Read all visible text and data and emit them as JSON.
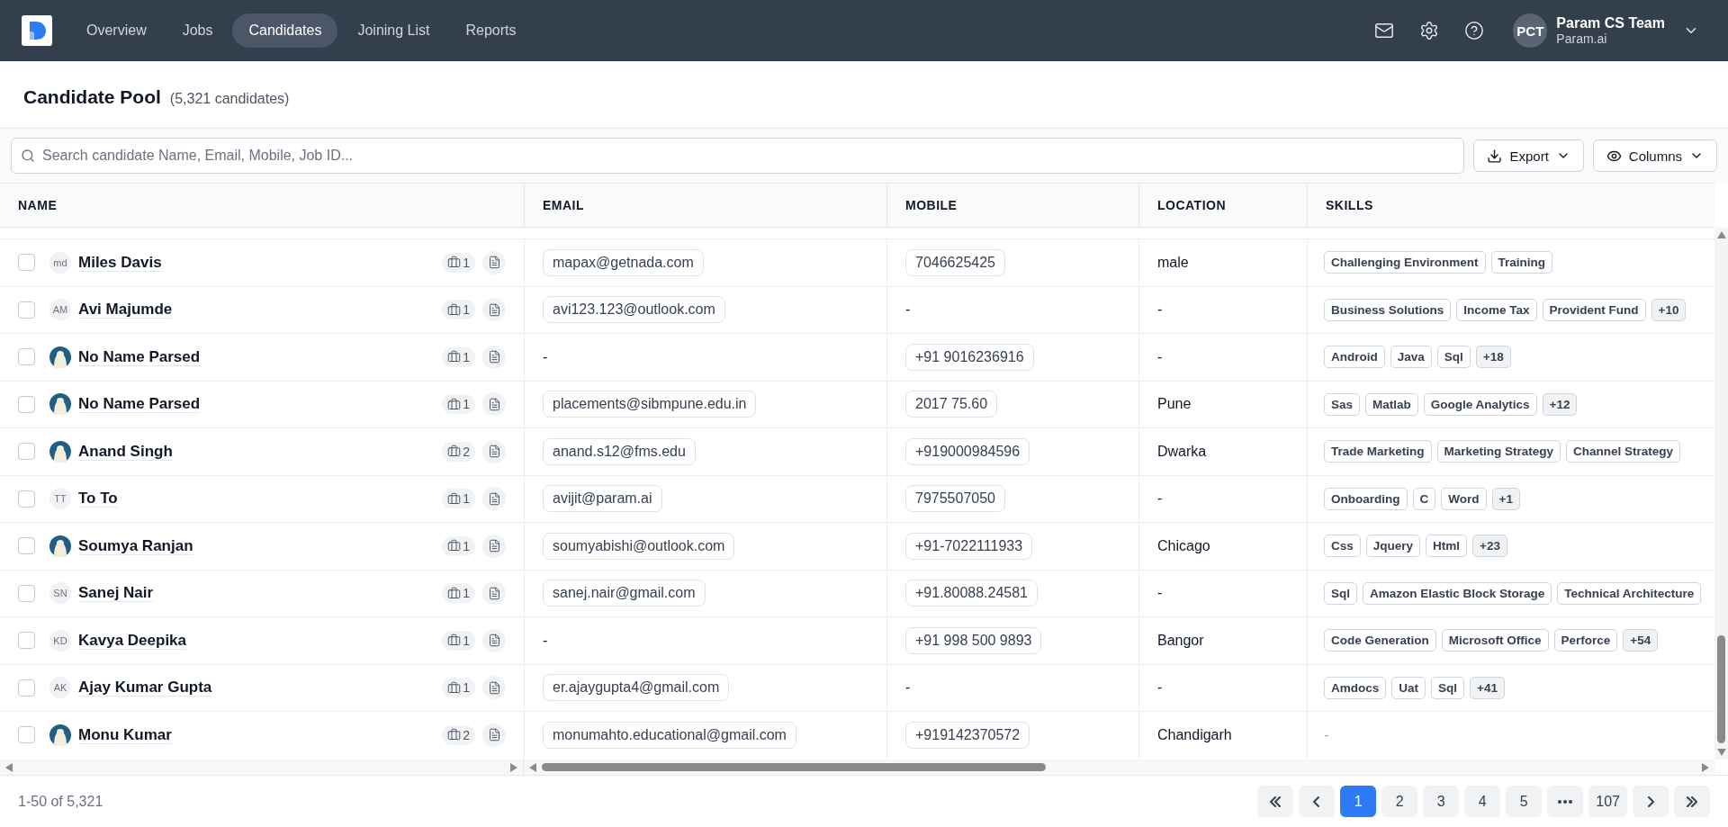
{
  "nav": {
    "tabs": [
      {
        "label": "Overview",
        "selected": false
      },
      {
        "label": "Jobs",
        "selected": false
      },
      {
        "label": "Candidates",
        "selected": true
      },
      {
        "label": "Joining List",
        "selected": false
      },
      {
        "label": "Reports",
        "selected": false
      }
    ],
    "user": {
      "initials": "PCT",
      "name": "Param CS Team",
      "org": "Param.ai"
    }
  },
  "page": {
    "title": "Candidate Pool",
    "count": "(5,321 candidates)"
  },
  "toolbar": {
    "search": {
      "placeholder": "Search candidate Name, Email, Mobile, Job ID..."
    },
    "buttons": [
      {
        "kind": "export",
        "label": "Export"
      },
      {
        "kind": "columns",
        "label": "Columns"
      }
    ]
  },
  "table": {
    "columns": [
      "NAME",
      "EMAIL",
      "MOBILE",
      "LOCATION",
      "SKILLS"
    ],
    "rows": [
      {
        "checked": false,
        "avatar": {
          "kind": "initials",
          "text": "md"
        },
        "name": "Miles Davis",
        "jobs": "1",
        "email": "mapax@getnada.com",
        "mobile": "7046625425",
        "location": "male",
        "skills": [
          {
            "kind": "skill",
            "label": "Challenging Environment"
          },
          {
            "kind": "skill",
            "label": "Training"
          }
        ]
      },
      {
        "checked": false,
        "avatar": {
          "kind": "initials",
          "text": "AM"
        },
        "name": "Avi Majumde",
        "jobs": "1",
        "email": "avi123.123@outlook.com",
        "mobile": "-",
        "location": "-",
        "skills": [
          {
            "kind": "skill",
            "label": "Business Solutions"
          },
          {
            "kind": "skill",
            "label": "Income Tax"
          },
          {
            "kind": "skill",
            "label": "Provident Fund"
          },
          {
            "kind": "more",
            "label": "+10"
          }
        ]
      },
      {
        "checked": false,
        "avatar": {
          "kind": "picture"
        },
        "name": "No Name Parsed",
        "jobs": "1",
        "email": "-",
        "mobile": "+91 9016236916",
        "location": "-",
        "skills": [
          {
            "kind": "skill",
            "label": "Android"
          },
          {
            "kind": "skill",
            "label": "Java"
          },
          {
            "kind": "skill",
            "label": "Sql"
          },
          {
            "kind": "more",
            "label": "+18"
          }
        ]
      },
      {
        "checked": false,
        "avatar": {
          "kind": "picture"
        },
        "name": "No Name Parsed",
        "jobs": "1",
        "email": "placements@sibmpune.edu.in",
        "mobile": "2017 75.60",
        "location": "Pune",
        "skills": [
          {
            "kind": "skill",
            "label": "Sas"
          },
          {
            "kind": "skill",
            "label": "Matlab"
          },
          {
            "kind": "skill",
            "label": "Google Analytics"
          },
          {
            "kind": "more",
            "label": "+12"
          }
        ]
      },
      {
        "checked": false,
        "avatar": {
          "kind": "picture"
        },
        "name": "Anand Singh",
        "jobs": "2",
        "email": "anand.s12@fms.edu",
        "mobile": "+919000984596",
        "location": "Dwarka",
        "skills": [
          {
            "kind": "skill",
            "label": "Trade Marketing"
          },
          {
            "kind": "skill",
            "label": "Marketing Strategy"
          },
          {
            "kind": "skill",
            "label": "Channel Strategy"
          }
        ]
      },
      {
        "checked": false,
        "avatar": {
          "kind": "initials",
          "text": "TT"
        },
        "name": "To To",
        "jobs": "1",
        "email": "avijit@param.ai",
        "mobile": "7975507050",
        "location": "-",
        "skills": [
          {
            "kind": "skill",
            "label": "Onboarding"
          },
          {
            "kind": "skill",
            "label": "C"
          },
          {
            "kind": "skill",
            "label": "Word"
          },
          {
            "kind": "more",
            "label": "+1"
          }
        ]
      },
      {
        "checked": false,
        "avatar": {
          "kind": "picture"
        },
        "name": "Soumya Ranjan",
        "jobs": "1",
        "email": "soumyabishi@outlook.com",
        "mobile": "+91-7022111933",
        "location": "Chicago",
        "skills": [
          {
            "kind": "skill",
            "label": "Css"
          },
          {
            "kind": "skill",
            "label": "Jquery"
          },
          {
            "kind": "skill",
            "label": "Html"
          },
          {
            "kind": "more",
            "label": "+23"
          }
        ]
      },
      {
        "checked": false,
        "avatar": {
          "kind": "initials",
          "text": "SN"
        },
        "name": "Sanej Nair",
        "jobs": "1",
        "email": "sanej.nair@gmail.com",
        "mobile": "+91.80088.24581",
        "location": "-",
        "skills": [
          {
            "kind": "skill",
            "label": "Sql"
          },
          {
            "kind": "skill",
            "label": "Amazon Elastic Block Storage"
          },
          {
            "kind": "skill",
            "label": "Technical Architecture"
          }
        ]
      },
      {
        "checked": false,
        "avatar": {
          "kind": "initials",
          "text": "KD"
        },
        "name": "Kavya Deepika",
        "jobs": "1",
        "email": "-",
        "mobile": "+91 998 500 9893",
        "location": "Bangor",
        "skills": [
          {
            "kind": "skill",
            "label": "Code Generation"
          },
          {
            "kind": "skill",
            "label": "Microsoft Office"
          },
          {
            "kind": "skill",
            "label": "Perforce"
          },
          {
            "kind": "more",
            "label": "+54"
          }
        ]
      },
      {
        "checked": false,
        "avatar": {
          "kind": "initials",
          "text": "AK"
        },
        "name": "Ajay Kumar Gupta",
        "jobs": "1",
        "email": "er.ajaygupta4@gmail.com",
        "mobile": "-",
        "location": "-",
        "skills": [
          {
            "kind": "skill",
            "label": "Amdocs"
          },
          {
            "kind": "skill",
            "label": "Uat"
          },
          {
            "kind": "skill",
            "label": "Sql"
          },
          {
            "kind": "more",
            "label": "+41"
          }
        ]
      },
      {
        "checked": false,
        "avatar": {
          "kind": "picture"
        },
        "name": "Monu Kumar",
        "jobs": "2",
        "email": "monumahto.educational@gmail.com",
        "mobile": "+919142370572",
        "location": "Chandigarh",
        "skills": [],
        "skills_empty": "-"
      }
    ]
  },
  "footer": {
    "range": "1-50 of 5,321",
    "pages": [
      {
        "kind": "first"
      },
      {
        "kind": "prev"
      },
      {
        "kind": "page",
        "label": "1",
        "selected": true
      },
      {
        "kind": "page",
        "label": "2",
        "selected": false
      },
      {
        "kind": "page",
        "label": "3",
        "selected": false
      },
      {
        "kind": "page",
        "label": "4",
        "selected": false
      },
      {
        "kind": "page",
        "label": "5",
        "selected": false
      },
      {
        "kind": "ellipsis"
      },
      {
        "kind": "page",
        "label": "107",
        "selected": false
      },
      {
        "kind": "next"
      },
      {
        "kind": "last"
      }
    ]
  }
}
